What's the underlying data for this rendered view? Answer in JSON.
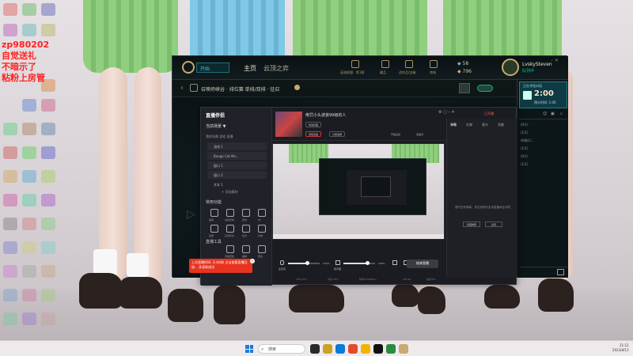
{
  "overlay_text": [
    "zp980202",
    "自觉送礼",
    "不暗示了",
    "粘粉上房管"
  ],
  "client": {
    "search_placeholder": "开始",
    "nav_home": "主页",
    "nav_tft": "云顶之弈",
    "nav_icons": [
      {
        "name": "profile-icon",
        "label": "英雄联盟 · 第1赛"
      },
      {
        "name": "collection-icon",
        "label": "藏品"
      },
      {
        "name": "loot-icon",
        "label": "战利品/宝箱"
      },
      {
        "name": "store-icon",
        "label": "商城"
      }
    ],
    "currency_be": "58",
    "currency_rp": "796",
    "username": "LvskySteven",
    "user_status": "队列中",
    "mode_title": "召唤师峡谷 · 排位赛 单排/双排 · 征召",
    "queue": {
      "title": "正在寻找对局",
      "time": "2:00",
      "sub": "预计时间: 1:00"
    },
    "friends": [
      "(0/1)",
      "(1/1)",
      "申请(1/...",
      "(1/1)",
      "(0/1)",
      "(1/1)"
    ]
  },
  "stream_app": {
    "logo": "直播伴侣",
    "scene_title": "当前场景 ▼",
    "scene_tabs": "我的场景   游戏   直播",
    "sources": [
      "游戏 1",
      "Bongo Cat Mv...",
      "窗口 1",
      "窗口 2",
      "文本 1"
    ],
    "add_source": "+ 添加素材",
    "section_common": "常用功能",
    "section_tools": "直播工具",
    "tools_row1": [
      "美颜",
      "虚拟形象",
      "连线",
      "PK"
    ],
    "tools_row2": [
      "投屏",
      "互动玩法",
      "任务",
      "礼物"
    ],
    "tools_row3": [
      "抽奖",
      "直播回放",
      "福袋",
      "更多"
    ],
    "notice": "上次直播时间: 2小时前 点击查看直播回放... 多读取成功",
    "room_name": "绝罚小头波弟99级的人",
    "btn_edit": "修改封面",
    "btn_game": "游戏直播",
    "btn_category": "分类选择",
    "meta1": "开播设置",
    "meta2": "直播间",
    "live_status": "已开播",
    "chat_tabs": [
      "弹幕",
      "礼物",
      "观众",
      "贡献"
    ],
    "chat_empty": "暂时没有弹幕，快去邀请好友来直播间互动吧",
    "chat_btn1": "隐藏弹幕",
    "chat_btn2": "设置",
    "mic_label": "麦克风",
    "mic_value": "100%",
    "spk_label": "扬声器",
    "spk_value": "100%",
    "mic_fill": 0.6,
    "spk_fill": 0.75,
    "go_live": "结束直播",
    "status_items": [
      "CPU:32%",
      "内存:45%",
      "码率:6000kbps",
      "FPS:60",
      "丢帧:0%"
    ]
  },
  "taskbar": {
    "search": "搜索",
    "time": "21:12",
    "date": "2023/8/13"
  },
  "colors": {
    "gold": "#c8aa6e",
    "teal": "#0acb9a",
    "alert": "#e8341f"
  }
}
